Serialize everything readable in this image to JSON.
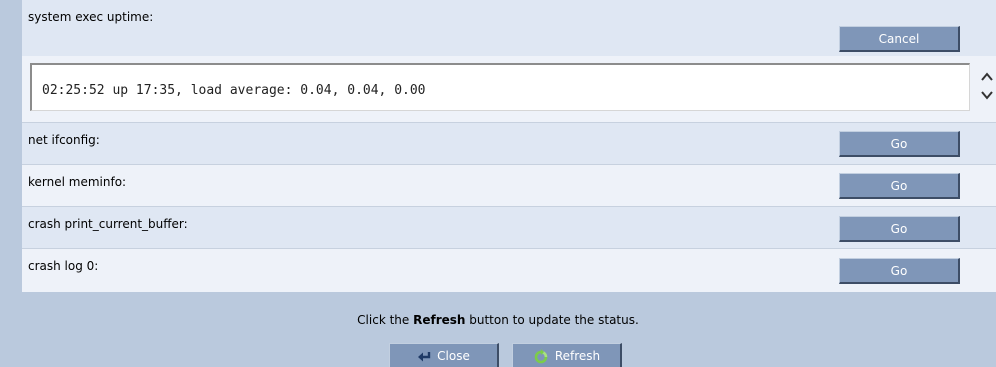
{
  "rows": [
    {
      "label": "system exec uptime:",
      "button": "Cancel"
    },
    {
      "label": "net ifconfig:",
      "button": "Go"
    },
    {
      "label": "kernel meminfo:",
      "button": "Go"
    },
    {
      "label": "crash print_current_buffer:",
      "button": "Go"
    },
    {
      "label": "crash log 0:",
      "button": "Go"
    }
  ],
  "output": {
    "text": "02:25:52 up 17:35, load average: 0.04, 0.04, 0.00"
  },
  "footer": {
    "message_prefix": "Click the ",
    "message_bold": "Refresh",
    "message_suffix": " button to update the status.",
    "close_label": "Close",
    "refresh_label": "Refresh"
  },
  "colors": {
    "page_bg": "#bac9dd",
    "row_light": "#dfe7f3",
    "row_alt": "#eef2f9",
    "button_bg": "#7f96b8",
    "refresh_icon": "#7ccd4a",
    "close_icon": "#1f3a66"
  },
  "icons": {
    "close": "return-arrow-icon",
    "refresh": "refresh-circle-icon",
    "scroll": "scroll-up-down-icon"
  }
}
